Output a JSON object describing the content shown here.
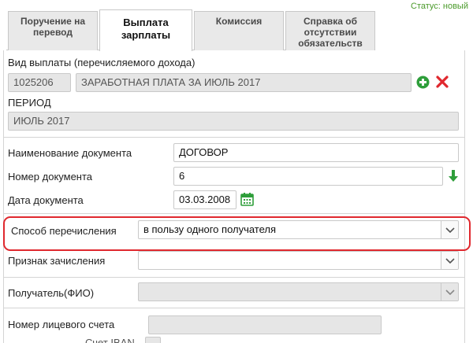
{
  "status": "Статус: новый",
  "tabs": [
    {
      "line1": "Поручение на",
      "line2": "перевод",
      "line3": ""
    },
    {
      "line1": "Выплата",
      "line2": "зарплаты",
      "line3": ""
    },
    {
      "line1": "Комиссия",
      "line2": "",
      "line3": ""
    },
    {
      "line1": "Справка об",
      "line2": "отсутствии",
      "line3": "обязательств"
    }
  ],
  "payment_type": {
    "label": "Вид выплаты (перечисляемого дохода)",
    "code": "1025206",
    "name": "ЗАРАБОТНАЯ ПЛАТА ЗА ИЮЛЬ 2017"
  },
  "period": {
    "label": "ПЕРИОД",
    "value": "ИЮЛЬ 2017"
  },
  "document": {
    "name_label": "Наименование документа",
    "name_value": "ДОГОВОР",
    "number_label": "Номер документа",
    "number_value": "6",
    "date_label": "Дата документа",
    "date_value": "03.03.2008"
  },
  "transfer_method": {
    "label": "Способ перечисления",
    "value": "в пользу одного получателя"
  },
  "credit_sign": {
    "label": "Признак зачисления",
    "value": ""
  },
  "recipient": {
    "label": "Получатель(ФИО)",
    "value": ""
  },
  "account": {
    "label": "Номер лицевого счета",
    "value": ""
  },
  "iban_label": "Счет IBAN",
  "colors": {
    "accent_green": "#2e9e3a",
    "delete_red": "#e0282e",
    "status_green": "#4a9a2a",
    "highlight_red": "#e0282e"
  }
}
